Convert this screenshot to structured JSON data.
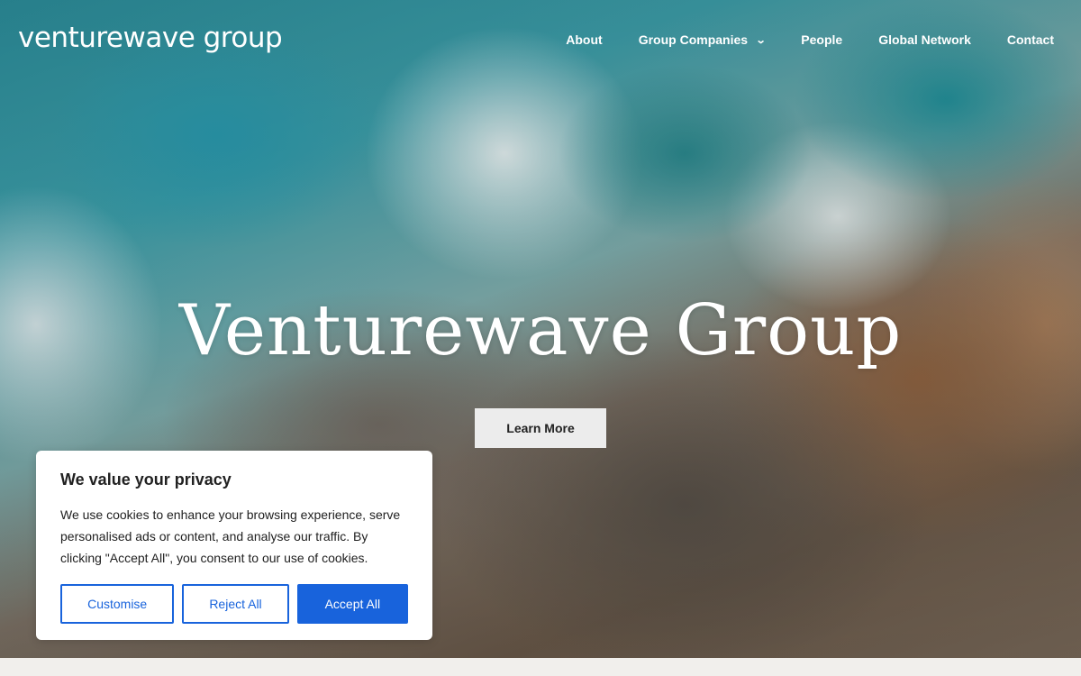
{
  "brand": {
    "logo_text": "venturewave group"
  },
  "nav": {
    "items": [
      {
        "label": "About"
      },
      {
        "label": "Group Companies",
        "has_dropdown": true
      },
      {
        "label": "People"
      },
      {
        "label": "Global Network"
      },
      {
        "label": "Contact"
      }
    ],
    "dropdown_icon": "chevron-down-icon"
  },
  "hero": {
    "title": "Venturewave Group",
    "cta_label": "Learn More",
    "background": "aerial-ocean-waves-rocks-photo"
  },
  "cookie_banner": {
    "title": "We value your privacy",
    "body": "We use cookies to enhance your browsing experience, serve personalised ads or content, and analyse our traffic. By clicking \"Accept All\", you consent to our use of cookies.",
    "customise_label": "Customise",
    "reject_label": "Reject All",
    "accept_label": "Accept All"
  },
  "colors": {
    "accent": "#1863dc",
    "nav_text": "#ffffff",
    "cta_bg": "#ececec",
    "page_bg": "#f1efec"
  }
}
